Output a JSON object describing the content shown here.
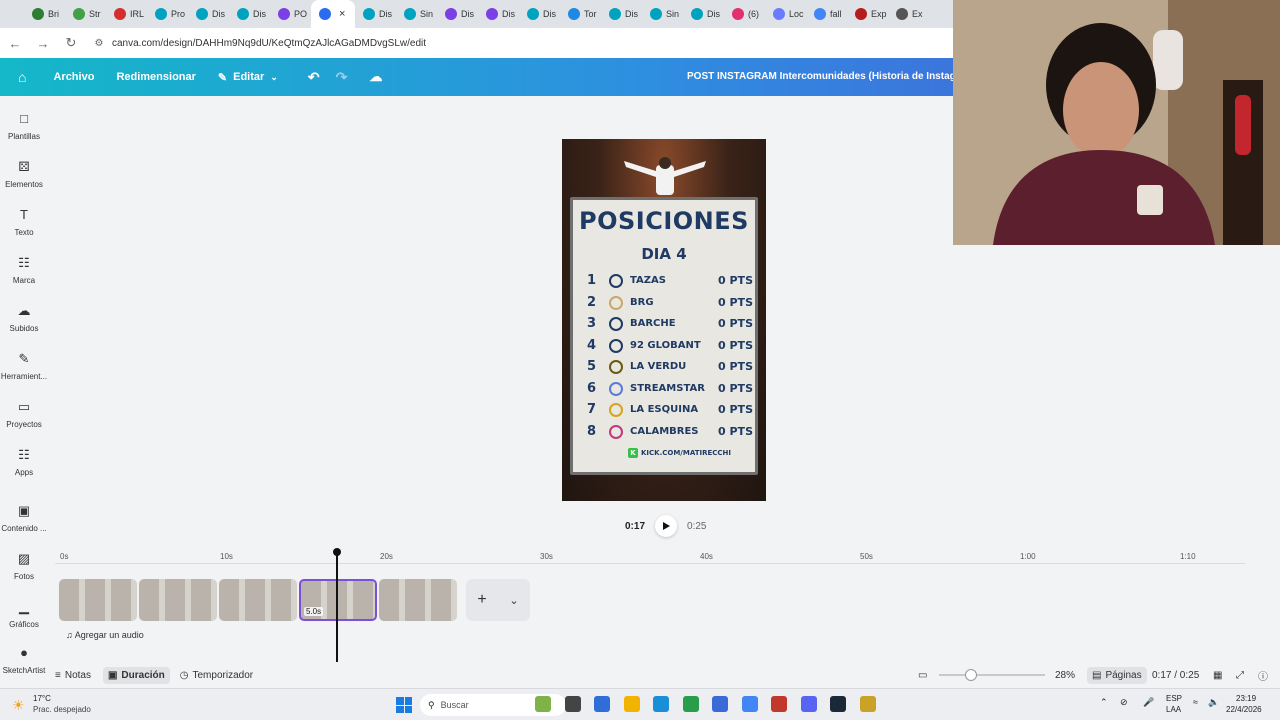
{
  "browser": {
    "tabs": [
      {
        "label": "Bri",
        "color": "#2e7d32"
      },
      {
        "label": "Str",
        "color": "#43a047"
      },
      {
        "label": "IRL",
        "color": "#d32f2f"
      },
      {
        "label": "Pro",
        "color": "#00a3bf"
      },
      {
        "label": "Dis",
        "color": "#00a3bf"
      },
      {
        "label": "Dis",
        "color": "#00a3bf"
      },
      {
        "label": "PO",
        "color": "#7b3fe4"
      },
      {
        "label": "",
        "color": "#2a6cf0",
        "active": true
      },
      {
        "label": "Dis",
        "color": "#00a3bf"
      },
      {
        "label": "Sin",
        "color": "#00a3bf"
      },
      {
        "label": "Dis",
        "color": "#7b3fe4"
      },
      {
        "label": "Dis",
        "color": "#7b3fe4"
      },
      {
        "label": "Dis",
        "color": "#00a3bf"
      },
      {
        "label": "Tor",
        "color": "#1e88e5"
      },
      {
        "label": "Dis",
        "color": "#00a3bf"
      },
      {
        "label": "Sin",
        "color": "#00a3bf"
      },
      {
        "label": "Dis",
        "color": "#00a3bf"
      },
      {
        "label": "(6)",
        "color": "#e1306c"
      },
      {
        "label": "Loc",
        "color": "#6b7bff"
      },
      {
        "label": "fall",
        "color": "#4285f4"
      },
      {
        "label": "Exp",
        "color": "#b71c1c"
      },
      {
        "label": "Ex",
        "color": "#555555"
      }
    ],
    "url": "canva.com/design/DAHHm9Nq9dU/KeQtmQzAJlcAGaDMDvgSLw/edit"
  },
  "toolbar": {
    "file": "Archivo",
    "resize": "Redimensionar",
    "edit": "Editar",
    "design_title": "POST INSTAGRAM Intercomunidades (Historia de Instagram"
  },
  "sidebar": {
    "items": [
      {
        "label": "Plantillas",
        "icon": "template-icon"
      },
      {
        "label": "Elementos",
        "icon": "elements-icon"
      },
      {
        "label": "Texto",
        "icon": "text-icon"
      },
      {
        "label": "Marca",
        "icon": "brand-icon"
      },
      {
        "label": "Subidos",
        "icon": "upload-icon"
      },
      {
        "label": "Herramient...",
        "icon": "tools-icon"
      },
      {
        "label": "Proyectos",
        "icon": "folder-icon"
      },
      {
        "label": "Apps",
        "icon": "apps-icon"
      },
      {
        "label": "Contenido ...",
        "icon": "content-icon"
      },
      {
        "label": "Fotos",
        "icon": "photos-icon"
      },
      {
        "label": "Gráficos",
        "icon": "charts-icon"
      },
      {
        "label": "SketchArtist",
        "icon": "sketch-icon"
      }
    ]
  },
  "poster": {
    "title": "POSICIONES",
    "subtitle": "DIA 4",
    "rows": [
      {
        "pos": "1",
        "team": "TAZAS",
        "pts": "0 PTS"
      },
      {
        "pos": "2",
        "team": "BRG",
        "pts": "0 PTS"
      },
      {
        "pos": "3",
        "team": "BARCHE",
        "pts": "0 PTS"
      },
      {
        "pos": "4",
        "team": "92 GLOBANT",
        "pts": "0 PTS"
      },
      {
        "pos": "5",
        "team": "LA VERDU",
        "pts": "0 PTS"
      },
      {
        "pos": "6",
        "team": "STREAMSTAR",
        "pts": "0 PTS"
      },
      {
        "pos": "7",
        "team": "LA ESQUINA",
        "pts": "0 PTS"
      },
      {
        "pos": "8",
        "team": "CALAMBRES",
        "pts": "0 PTS"
      }
    ],
    "footer": "KICK.COM/MATIRECCHI"
  },
  "playback": {
    "current": "0:17",
    "total": "0:25"
  },
  "timeline": {
    "ticks": [
      "0s",
      "10s",
      "20s",
      "30s",
      "40s",
      "50s",
      "1:00",
      "1:10"
    ],
    "selected_clip_duration": "5.0s",
    "add_audio": "Agregar un audio"
  },
  "bottombar": {
    "notes": "Notas",
    "duration": "Duración",
    "timer": "Temporizador",
    "zoom": "28%",
    "pages": "Páginas",
    "time": "0:17 / 0:25"
  },
  "taskbar": {
    "weather_temp": "17°C",
    "weather_desc": "Prac. despejado",
    "search": "Buscar",
    "lang1": "ESP",
    "lang2": "LAA",
    "clock_time": "23:19",
    "clock_date": "22/4/2026"
  }
}
